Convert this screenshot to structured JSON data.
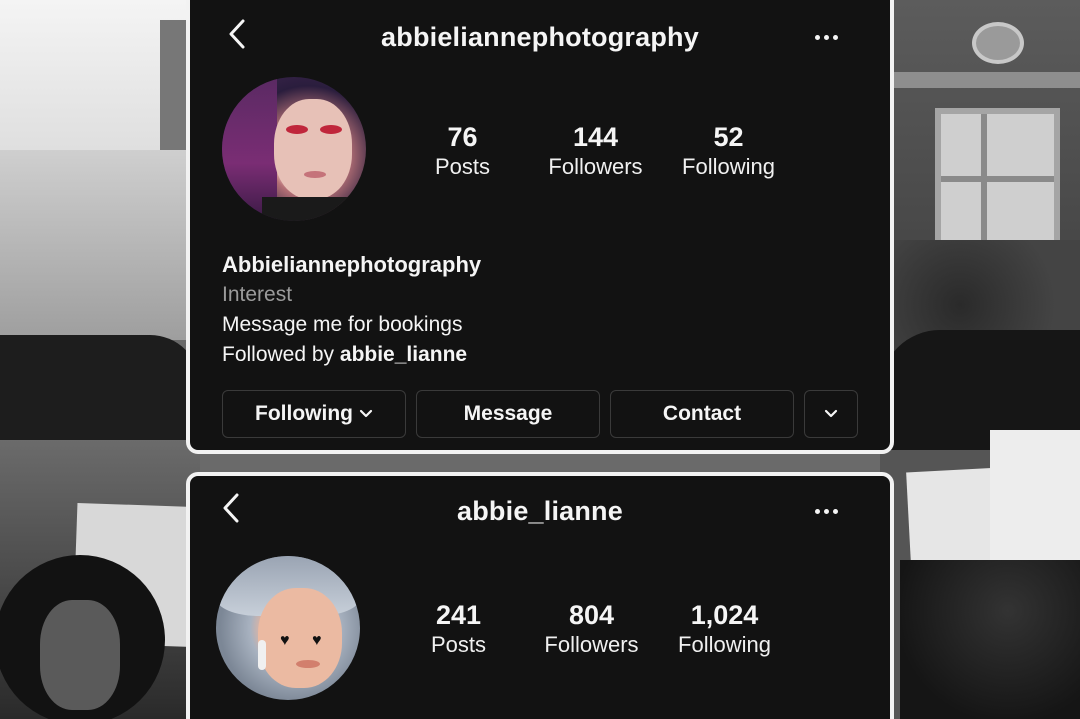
{
  "profile_1": {
    "username": "abbieliannephotography",
    "stats": [
      {
        "value": "76",
        "label": "Posts"
      },
      {
        "value": "144",
        "label": "Followers"
      },
      {
        "value": "52",
        "label": "Following"
      }
    ],
    "display_name": "Abbieliannephotography",
    "category": "Interest",
    "bio": "Message me for bookings",
    "followed_by_prefix": "Followed by ",
    "followed_by_user": "abbie_lianne",
    "buttons": {
      "following": "Following",
      "message": "Message",
      "contact": "Contact"
    }
  },
  "profile_2": {
    "username": "abbie_lianne",
    "stats": [
      {
        "value": "241",
        "label": "Posts"
      },
      {
        "value": "804",
        "label": "Followers"
      },
      {
        "value": "1,024",
        "label": "Following"
      }
    ]
  },
  "icons": {
    "back": "chevron-left-icon",
    "more": "more-horizontal-icon",
    "dropdown": "chevron-down-icon"
  },
  "colors": {
    "card_background": "#121212",
    "card_border": "#f2f2f2",
    "text_primary": "#f5f5f5",
    "text_secondary": "#9a9a9a",
    "button_border": "#3a3a3a"
  }
}
